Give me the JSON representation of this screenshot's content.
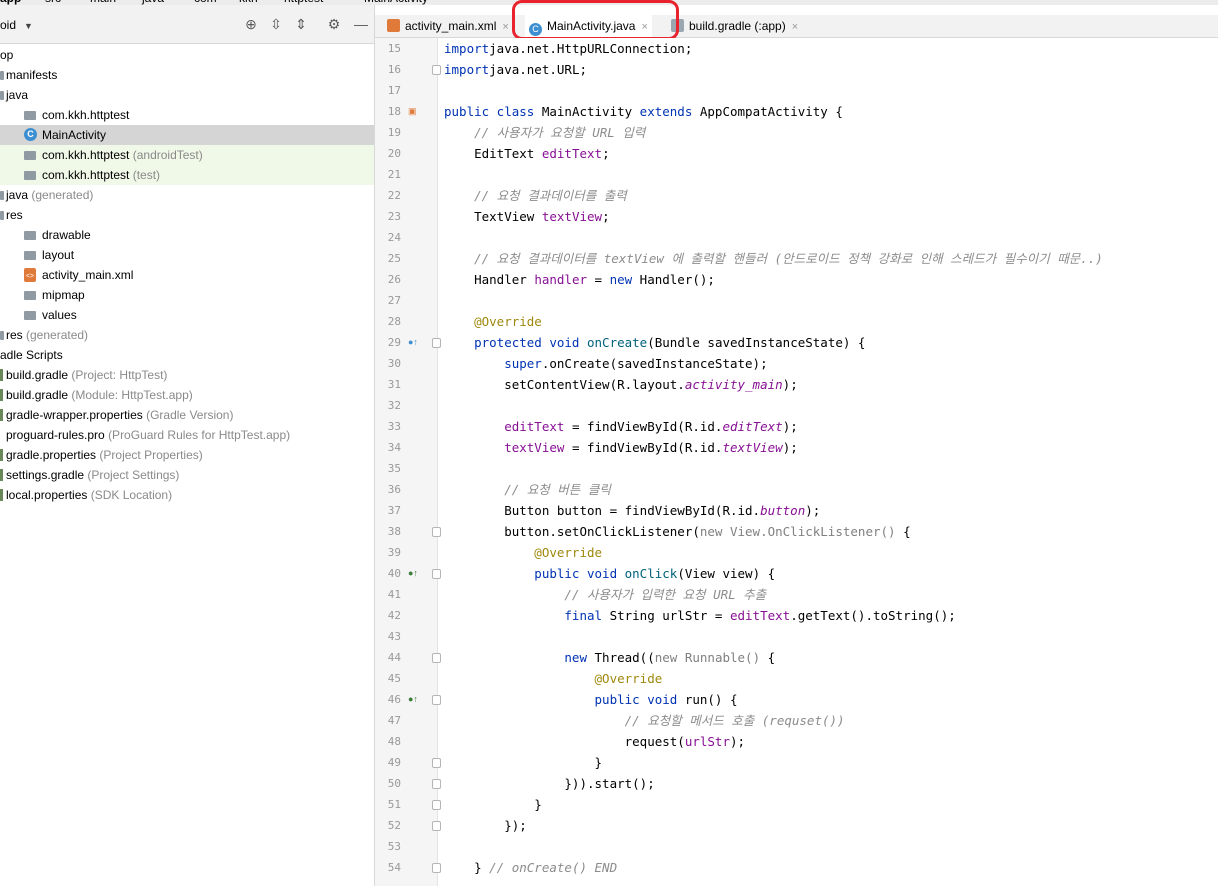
{
  "breadcrumb": [
    "app",
    "src",
    "main",
    "java",
    "com",
    "kkh",
    "httptest",
    "MainActivity"
  ],
  "project_panel": {
    "view_selector": "oid",
    "items": [
      {
        "label": "op",
        "hint": "",
        "level": 0,
        "icon": "none"
      },
      {
        "label": "manifests",
        "hint": "",
        "level": 0,
        "icon": "folder"
      },
      {
        "label": "java",
        "hint": "",
        "level": 0,
        "icon": "folder"
      },
      {
        "label": "com.kkh.httptest",
        "hint": "",
        "level": 1,
        "icon": "package"
      },
      {
        "label": "MainActivity",
        "hint": "",
        "level": 2,
        "icon": "class",
        "selected": true
      },
      {
        "label": "com.kkh.httptest",
        "hint": "(androidTest)",
        "level": 1,
        "icon": "package",
        "test": true
      },
      {
        "label": "com.kkh.httptest",
        "hint": "(test)",
        "level": 1,
        "icon": "package",
        "test": true
      },
      {
        "label": "java",
        "hint": "(generated)",
        "level": 0,
        "icon": "folder"
      },
      {
        "label": "res",
        "hint": "",
        "level": 0,
        "icon": "folder"
      },
      {
        "label": "drawable",
        "hint": "",
        "level": 1,
        "icon": "folder"
      },
      {
        "label": "layout",
        "hint": "",
        "level": 1,
        "icon": "folder"
      },
      {
        "label": "activity_main.xml",
        "hint": "",
        "level": 2,
        "icon": "xml"
      },
      {
        "label": "mipmap",
        "hint": "",
        "level": 1,
        "icon": "folder"
      },
      {
        "label": "values",
        "hint": "",
        "level": 1,
        "icon": "folder"
      },
      {
        "label": "res",
        "hint": "(generated)",
        "level": 0,
        "icon": "folder"
      },
      {
        "label": "adle Scripts",
        "hint": "",
        "level": 0,
        "icon": "none"
      },
      {
        "label": "build.gradle",
        "hint": "(Project: HttpTest)",
        "level": 0,
        "icon": "gradle"
      },
      {
        "label": "build.gradle",
        "hint": "(Module: HttpTest.app)",
        "level": 0,
        "icon": "gradle"
      },
      {
        "label": "gradle-wrapper.properties",
        "hint": "(Gradle Version)",
        "level": 0,
        "icon": "properties"
      },
      {
        "label": "proguard-rules.pro",
        "hint": "(ProGuard Rules for HttpTest.app)",
        "level": 0,
        "icon": "none"
      },
      {
        "label": "gradle.properties",
        "hint": "(Project Properties)",
        "level": 0,
        "icon": "properties"
      },
      {
        "label": "settings.gradle",
        "hint": "(Project Settings)",
        "level": 0,
        "icon": "gradle"
      },
      {
        "label": "local.properties",
        "hint": "(SDK Location)",
        "level": 0,
        "icon": "properties"
      }
    ]
  },
  "tabs": [
    {
      "label": "activity_main.xml",
      "close": "×",
      "icon": "xml-icon"
    },
    {
      "label": "MainActivity.java",
      "close": "×",
      "icon": "class-icon",
      "active": true
    },
    {
      "label": "build.gradle (:app)",
      "close": "×",
      "icon": "gradle-icon"
    }
  ],
  "code_lines": [
    {
      "n": "15",
      "tokens": [
        [
          "kw",
          "import"
        ],
        [
          "",
          "java.net.HttpURLConnection;"
        ]
      ]
    },
    {
      "n": "16",
      "tokens": [
        [
          "kw",
          "import"
        ],
        [
          "",
          "java.net.URL;"
        ]
      ]
    },
    {
      "n": "17",
      "tokens": []
    },
    {
      "n": "18",
      "tokens": [
        [
          "kw",
          "public class"
        ],
        [
          "",
          " MainActivity "
        ],
        [
          "kw",
          "extends"
        ],
        [
          "",
          " AppCompatActivity {"
        ]
      ]
    },
    {
      "n": "19",
      "tokens": [
        [
          "cm",
          "    // 사용자가 요청할 URL 입력"
        ]
      ]
    },
    {
      "n": "20",
      "tokens": [
        [
          "",
          "    EditText "
        ],
        [
          "fld",
          "editText"
        ],
        [
          "",
          ";"
        ]
      ]
    },
    {
      "n": "21",
      "tokens": []
    },
    {
      "n": "22",
      "tokens": [
        [
          "cm",
          "    // 요청 결과데이터를 출력"
        ]
      ]
    },
    {
      "n": "23",
      "tokens": [
        [
          "",
          "    TextView "
        ],
        [
          "fld",
          "textView"
        ],
        [
          "",
          ";"
        ]
      ]
    },
    {
      "n": "24",
      "tokens": []
    },
    {
      "n": "25",
      "tokens": [
        [
          "cm",
          "    // 요청 결과데이터를 textView 에 출력할 핸들러 (안드로이드 정책 강화로 인해 스레드가 필수이기 때문..)"
        ]
      ]
    },
    {
      "n": "26",
      "tokens": [
        [
          "",
          "    Handler "
        ],
        [
          "fld",
          "handler"
        ],
        [
          "",
          " = "
        ],
        [
          "kw",
          "new"
        ],
        [
          "",
          " Handler();"
        ]
      ]
    },
    {
      "n": "27",
      "tokens": []
    },
    {
      "n": "28",
      "tokens": [
        [
          "an",
          "    @Override"
        ]
      ]
    },
    {
      "n": "29",
      "tokens": [
        [
          "kw",
          "    protected void"
        ],
        [
          "",
          " "
        ],
        [
          "fn",
          "onCreate"
        ],
        [
          "",
          "(Bundle savedInstanceState) {"
        ]
      ]
    },
    {
      "n": "30",
      "tokens": [
        [
          "kw",
          "        super"
        ],
        [
          "",
          ".onCreate(savedInstanceState);"
        ]
      ]
    },
    {
      "n": "31",
      "tokens": [
        [
          "",
          "        setContentView(R.layout."
        ],
        [
          "fldi",
          "activity_main"
        ],
        [
          "",
          ");"
        ]
      ]
    },
    {
      "n": "32",
      "tokens": []
    },
    {
      "n": "33",
      "tokens": [
        [
          "fld",
          "        editText"
        ],
        [
          "",
          " = findViewById(R.id."
        ],
        [
          "fldi",
          "editText"
        ],
        [
          "",
          ");"
        ]
      ]
    },
    {
      "n": "34",
      "tokens": [
        [
          "fld",
          "        textView"
        ],
        [
          "",
          " = findViewById(R.id."
        ],
        [
          "fldi",
          "textView"
        ],
        [
          "",
          ");"
        ]
      ]
    },
    {
      "n": "35",
      "tokens": []
    },
    {
      "n": "36",
      "tokens": [
        [
          "cm",
          "        // 요청 버튼 클릭"
        ]
      ]
    },
    {
      "n": "37",
      "tokens": [
        [
          "",
          "        Button button = findViewById(R.id."
        ],
        [
          "fldi",
          "button"
        ],
        [
          "",
          ");"
        ]
      ]
    },
    {
      "n": "38",
      "tokens": [
        [
          "",
          "        button.setOnClickListener("
        ],
        [
          "gr",
          "new View.OnClickListener()"
        ],
        [
          "",
          " {"
        ]
      ]
    },
    {
      "n": "39",
      "tokens": [
        [
          "an",
          "            @Override"
        ]
      ]
    },
    {
      "n": "40",
      "tokens": [
        [
          "kw",
          "            public void"
        ],
        [
          "",
          " "
        ],
        [
          "fn",
          "onClick"
        ],
        [
          "",
          "(View view) {"
        ]
      ]
    },
    {
      "n": "41",
      "tokens": [
        [
          "cm",
          "                // 사용자가 입력한 요청 URL 추출"
        ]
      ]
    },
    {
      "n": "42",
      "tokens": [
        [
          "kw",
          "                final"
        ],
        [
          "",
          " String urlStr = "
        ],
        [
          "fld",
          "editText"
        ],
        [
          "",
          ".getText().toString();"
        ]
      ]
    },
    {
      "n": "43",
      "tokens": []
    },
    {
      "n": "44",
      "tokens": [
        [
          "kw",
          "                new"
        ],
        [
          "",
          " Thread(("
        ],
        [
          "gr",
          "new Runnable()"
        ],
        [
          "",
          " {"
        ]
      ]
    },
    {
      "n": "45",
      "tokens": [
        [
          "an",
          "                    @Override"
        ]
      ]
    },
    {
      "n": "46",
      "tokens": [
        [
          "kw",
          "                    public void"
        ],
        [
          "",
          " run() {"
        ]
      ]
    },
    {
      "n": "47",
      "tokens": [
        [
          "cm",
          "                        // 요청할 메서드 호출 (requset())"
        ]
      ]
    },
    {
      "n": "48",
      "tokens": [
        [
          "",
          "                        request("
        ],
        [
          "fld",
          "urlStr"
        ],
        [
          "",
          ");"
        ]
      ]
    },
    {
      "n": "49",
      "tokens": [
        [
          "",
          "                    }"
        ]
      ]
    },
    {
      "n": "50",
      "tokens": [
        [
          "",
          "                })).start();"
        ]
      ]
    },
    {
      "n": "51",
      "tokens": [
        [
          "",
          "            }"
        ]
      ]
    },
    {
      "n": "52",
      "tokens": [
        [
          "",
          "        });"
        ]
      ]
    },
    {
      "n": "53",
      "tokens": []
    },
    {
      "n": "54",
      "tokens": [
        [
          "",
          "    } "
        ],
        [
          "cm",
          "// onCreate() END"
        ]
      ]
    }
  ],
  "gutter_marks": {
    "18": "xml-icon",
    "29": "override-up-icon",
    "40": "implements-up-icon",
    "46": "implements-up-icon"
  },
  "fold_lines": [
    "16",
    "29",
    "38",
    "40",
    "44",
    "46",
    "49",
    "50",
    "51",
    "52",
    "54"
  ]
}
